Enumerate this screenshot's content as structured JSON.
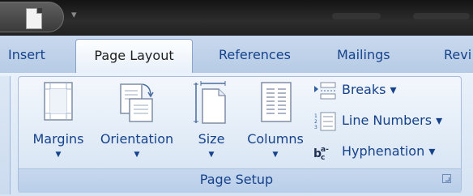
{
  "quick_access": {
    "dropdown_glyph": "▾"
  },
  "tabs": {
    "items": [
      "Insert",
      "Page Layout",
      "References",
      "Mailings",
      "Revi"
    ],
    "active": "Page Layout"
  },
  "page_setup": {
    "group_label": "Page Setup",
    "large_buttons": [
      {
        "label": "Margins",
        "icon": "margins-icon"
      },
      {
        "label": "Orientation",
        "icon": "orientation-icon"
      },
      {
        "label": "Size",
        "icon": "size-icon"
      },
      {
        "label": "Columns",
        "icon": "columns-icon"
      }
    ],
    "small_buttons": [
      {
        "label": "Breaks",
        "icon": "breaks-icon"
      },
      {
        "label": "Line Numbers",
        "icon": "line-numbers-icon"
      },
      {
        "label": "Hyphenation",
        "icon": "hyphenation-icon"
      }
    ],
    "hyphenation_glyph": "bc"
  },
  "colors": {
    "tab_text": "#15428b",
    "ribbon_bg": "#dce8f5"
  }
}
